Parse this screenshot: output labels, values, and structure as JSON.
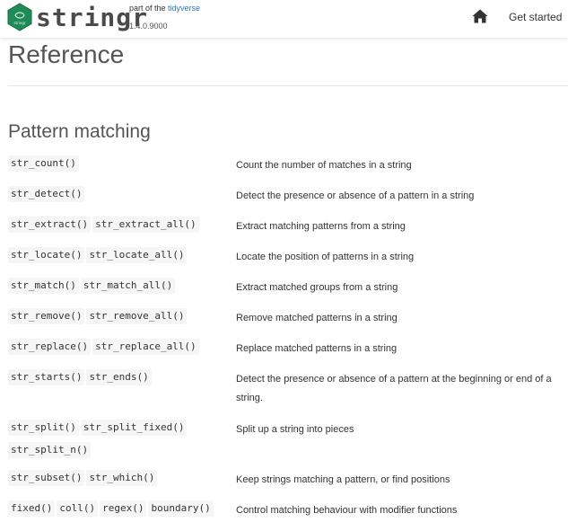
{
  "header": {
    "brand": "stringr",
    "tagline_prefix": "part of the ",
    "tagline_link": "tidyverse",
    "version": "1.4.0.9000",
    "home_icon": "home-icon",
    "nav_get_started": "Get started"
  },
  "page": {
    "title": "Reference",
    "section_title": "Pattern matching"
  },
  "colors": {
    "link": "#2a77c4",
    "logo": "#1f8b57",
    "code_bg": "#f6f6f6"
  },
  "rows": [
    {
      "funcs": [
        "str_count()"
      ],
      "desc": "Count the number of matches in a string"
    },
    {
      "funcs": [
        "str_detect()"
      ],
      "desc": "Detect the presence or absence of a pattern in a string"
    },
    {
      "funcs": [
        "str_extract()",
        "str_extract_all()"
      ],
      "desc": "Extract matching patterns from a string"
    },
    {
      "funcs": [
        "str_locate()",
        "str_locate_all()"
      ],
      "desc": "Locate the position of patterns in a string"
    },
    {
      "funcs": [
        "str_match()",
        "str_match_all()"
      ],
      "desc": "Extract matched groups from a string"
    },
    {
      "funcs": [
        "str_remove()",
        "str_remove_all()"
      ],
      "desc": "Remove matched patterns in a string"
    },
    {
      "funcs": [
        "str_replace()",
        "str_replace_all()"
      ],
      "desc": "Replace matched patterns in a string"
    },
    {
      "funcs": [
        "str_starts()",
        "str_ends()"
      ],
      "desc": "Detect the presence or absence of a pattern at the beginning or end of a string."
    },
    {
      "funcs": [
        "str_split()",
        "str_split_fixed()",
        "str_split_n()"
      ],
      "desc": "Split up a string into pieces"
    },
    {
      "funcs": [
        "str_subset()",
        "str_which()"
      ],
      "desc": "Keep strings matching a pattern, or find positions"
    },
    {
      "funcs": [
        "fixed()",
        "coll()",
        "regex()",
        "boundary()"
      ],
      "desc": "Control matching behaviour with modifier functions"
    }
  ]
}
